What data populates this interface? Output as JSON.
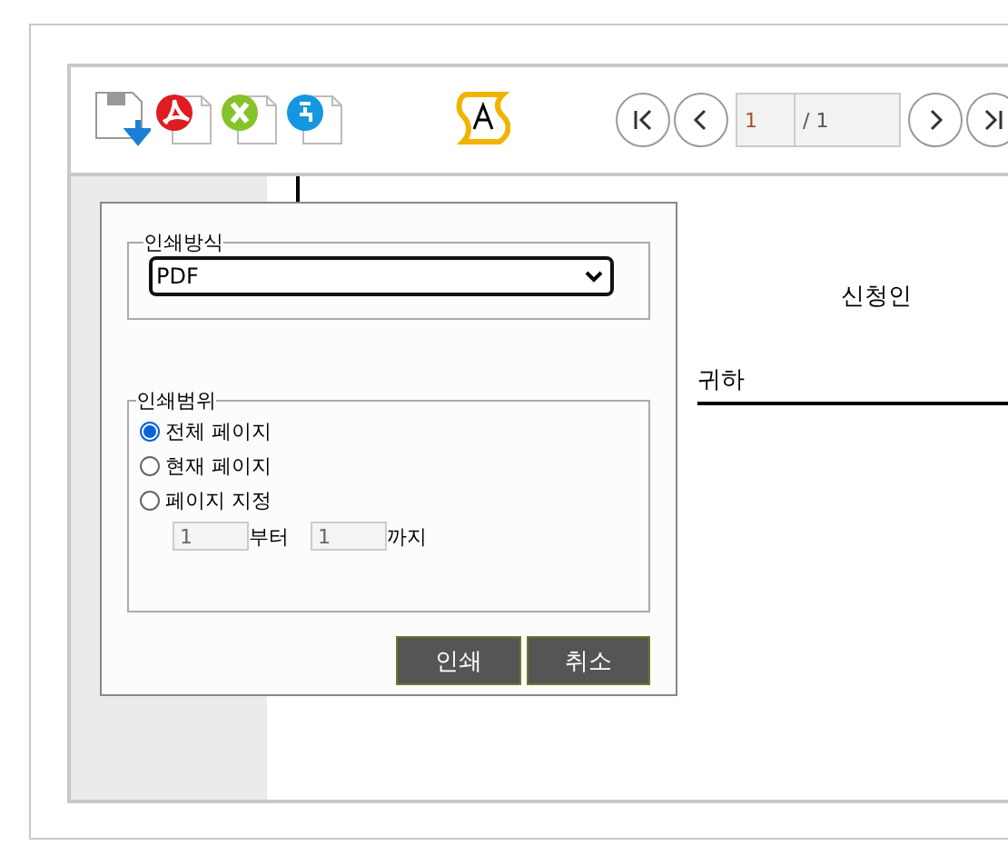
{
  "toolbar": {
    "page_input": {
      "value": "1"
    },
    "page_total": "/ 1"
  },
  "document": {
    "applicant_label": "신청인",
    "recipient_label": "귀하"
  },
  "dialog": {
    "method": {
      "legend": "인쇄방식",
      "value": "PDF"
    },
    "range": {
      "legend": "인쇄범위",
      "options": [
        {
          "label": "전체 페이지",
          "selected": true
        },
        {
          "label": "현재 페이지",
          "selected": false
        },
        {
          "label": "페이지 지정",
          "selected": false
        }
      ],
      "from": {
        "value": "1",
        "suffix": "부터"
      },
      "to": {
        "value": "1",
        "suffix": "까지"
      }
    },
    "buttons": [
      {
        "label": "인쇄",
        "kind": "primary"
      },
      {
        "label": "취소",
        "kind": "cancel"
      }
    ]
  }
}
